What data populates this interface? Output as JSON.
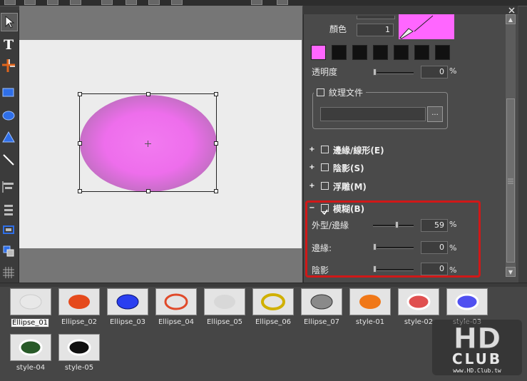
{
  "panel": {
    "color_label": "顏色",
    "color_value": "1",
    "color_preview": "#ff66ff",
    "swatches": [
      "#ff66ff",
      "#111111",
      "#111111",
      "#111111",
      "#111111",
      "#111111",
      "#111111"
    ],
    "opacity_label": "透明度",
    "opacity_value": "0",
    "opacity_unit": "%",
    "texture_label": "紋理文件",
    "browse_label": "...",
    "sections": [
      {
        "label": "邊緣/線形(E)",
        "expanded": false,
        "checked": false
      },
      {
        "label": "陰影(S)",
        "expanded": false,
        "checked": false
      },
      {
        "label": "浮雕(M)",
        "expanded": false,
        "checked": false
      },
      {
        "label": "模糊(B)",
        "expanded": true,
        "checked": true
      }
    ],
    "blur": {
      "shape_label": "外型/邊緣",
      "shape_value": "59",
      "edge_label": "邊緣:",
      "edge_value": "0",
      "shadow_label": "陰影",
      "shadow_value": "0",
      "unit": "%",
      "highlight_color": "#d01818"
    }
  },
  "gallery": {
    "items": [
      {
        "label": "Ellipse_01",
        "selected": true
      },
      {
        "label": "Ellipse_02"
      },
      {
        "label": "Ellipse_03"
      },
      {
        "label": "Ellipse_04"
      },
      {
        "label": "Ellipse_05"
      },
      {
        "label": "Ellipse_06"
      },
      {
        "label": "Ellipse_07"
      },
      {
        "label": "style-01"
      },
      {
        "label": "style-02"
      },
      {
        "label": "style-03"
      },
      {
        "label": "style-04"
      },
      {
        "label": "style-05"
      }
    ]
  },
  "watermark": {
    "logo_text": "HD",
    "club_text": "CLUB",
    "url": "www.HD.Club.tw"
  },
  "colors": {
    "ellipse_fill": "#ee6eec",
    "canvas_bg": "#ececec"
  }
}
